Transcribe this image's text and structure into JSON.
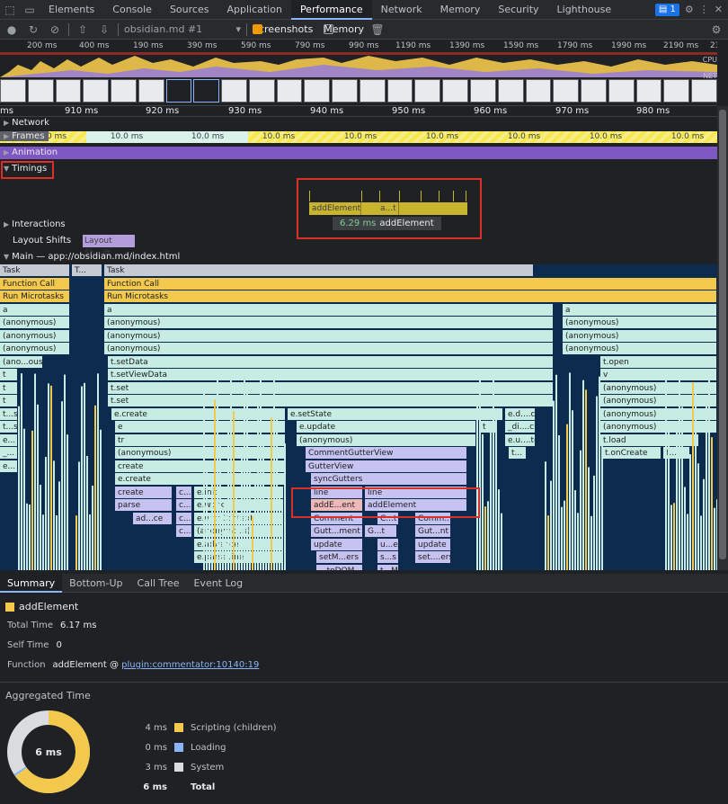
{
  "devtools_tabs": [
    "Elements",
    "Console",
    "Sources",
    "Application",
    "Performance",
    "Network",
    "Memory",
    "Security",
    "Lighthouse"
  ],
  "active_tab": "Performance",
  "issues_count": "1",
  "toolbar": {
    "profile": "obsidian.md #1",
    "screenshots_label": "Screenshots",
    "memory_label": "Memory"
  },
  "overview_ticks": [
    "200 ms",
    "400 ms",
    "190 ms",
    "390 ms",
    "590 ms",
    "790 ms",
    "990 ms",
    "1190 ms",
    "1390 ms",
    "1590 ms",
    "1790 ms",
    "1990 ms",
    "2190 ms",
    "2390"
  ],
  "overview_labels": {
    "cpu": "CPU",
    "net": "NET"
  },
  "ruler_ticks": [
    "ms",
    "910 ms",
    "920 ms",
    "930 ms",
    "940 ms",
    "950 ms",
    "960 ms",
    "970 ms",
    "980 ms"
  ],
  "tracks": {
    "network": "Network",
    "frames": "Frames",
    "animation": "Animation",
    "timings": "Timings",
    "interactions": "Interactions",
    "layout_shifts": "Layout Shifts",
    "main": "Main — app://obsidian.md/index.html"
  },
  "frame_labels": [
    "0 ms",
    "10.0 ms",
    "10.0 ms",
    "10.0 ms",
    "10.0 ms",
    "10.0 ms",
    "10.0 ms",
    "10.0 ms",
    "10.0 ms"
  ],
  "timing_segments": [
    "addElement",
    "a...t"
  ],
  "tooltip": {
    "ms": "6.29 ms",
    "name": "addElement"
  },
  "layout_shift_label": "Layout Sh...ift",
  "flame": {
    "r0": [
      "Task",
      "T...",
      "Task"
    ],
    "r1": [
      "Function Call",
      "Function Call"
    ],
    "r2": [
      "Run Microtasks",
      "Run Microtasks"
    ],
    "r3": [
      "a",
      "a",
      "a"
    ],
    "r4": [
      "(anonymous)",
      "(anonymous)",
      "(anonymous)"
    ],
    "r5": [
      "(anonymous)",
      "(anonymous)",
      "(anonymous)"
    ],
    "r6": [
      "(anonymous)",
      "(anonymous)",
      "(anonymous)"
    ],
    "r7": [
      "(ano...ous)",
      "t.setData",
      "t.open"
    ],
    "r8": [
      "t",
      "t.setViewData",
      "v"
    ],
    "r9": [
      "t",
      "t.set",
      "(anonymous)"
    ],
    "r10": [
      "t",
      "t.set",
      "(anonymous)"
    ],
    "r11": [
      "t...s",
      "e.create",
      "e.setState",
      "e.d....ch",
      "(anonymous)"
    ],
    "r12": [
      "t...s",
      "e",
      "e.update",
      "t",
      "_di....ch",
      "(anonymous)"
    ],
    "r13": [
      "e...",
      "tr",
      "(anonymous)",
      "e.u....te",
      "t.load"
    ],
    "r14": [
      "_...",
      "(anonymous)",
      "CommentGutterView",
      "t...",
      "t.onCreate",
      "t..."
    ],
    "r15": [
      "e...",
      "create",
      "GutterView"
    ],
    "r16": [
      "e.create",
      "syncGutters"
    ],
    "r17": [
      "create",
      "c...",
      "e.init",
      "line",
      "line"
    ],
    "r18": [
      "parse",
      "c...",
      "e.work",
      "addE...ent",
      "addElement"
    ],
    "r19": [
      "ad...ce",
      "c...",
      "e.withContext",
      "Comment",
      "C...t",
      "Comm..."
    ],
    "r20": [
      "c...",
      "(anonymous)",
      "Gutt...ment",
      "G...t",
      "Gut...nt"
    ],
    "r21": [
      "e.advance",
      "update",
      "u...e",
      "update"
    ],
    "r22": [
      "e.parseLine",
      "setM...ers",
      "s...s",
      "set....ers"
    ],
    "r23": [
      "...toDOM",
      "t...M"
    ]
  },
  "bottom_tabs": [
    "Summary",
    "Bottom-Up",
    "Call Tree",
    "Event Log"
  ],
  "summary": {
    "title": "addElement",
    "total_time_label": "Total Time",
    "total_time": "6.17 ms",
    "self_time_label": "Self Time",
    "self_time": "0",
    "function_label": "Function",
    "function_name": "addElement @",
    "function_link": "plugin:commentator:10140:19"
  },
  "aggregated": {
    "title": "Aggregated Time",
    "center": "6 ms",
    "rows": [
      {
        "value": "4 ms",
        "name": "Scripting (children)",
        "color": "#f2c94c"
      },
      {
        "value": "0 ms",
        "name": "Loading",
        "color": "#8ab4f8"
      },
      {
        "value": "3 ms",
        "name": "System",
        "color": "#dadce0"
      }
    ],
    "total_value": "6 ms",
    "total_name": "Total"
  }
}
